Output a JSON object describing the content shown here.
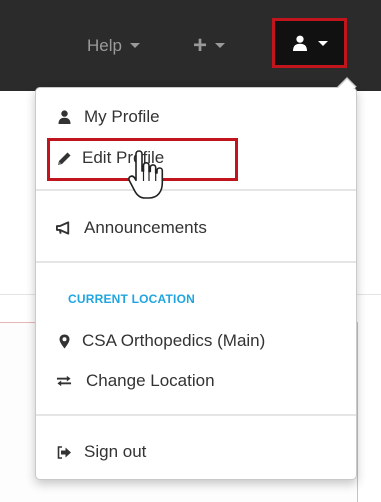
{
  "navbar": {
    "help_label": "Help",
    "icons": {
      "help_caret": "caret-down-icon",
      "plus": "plus-icon",
      "user": "user-icon"
    }
  },
  "menu": {
    "my_profile": "My Profile",
    "edit_profile": "Edit Profile",
    "announcements": "Announcements",
    "current_location_header": "CURRENT LOCATION",
    "location_name": "CSA Orthopedics (Main)",
    "change_location": "Change Location",
    "sign_out": "Sign out"
  },
  "colors": {
    "navbar_bg": "#2b2b2b",
    "highlight_red": "#c0151c",
    "header_blue": "#1fa5e0"
  }
}
